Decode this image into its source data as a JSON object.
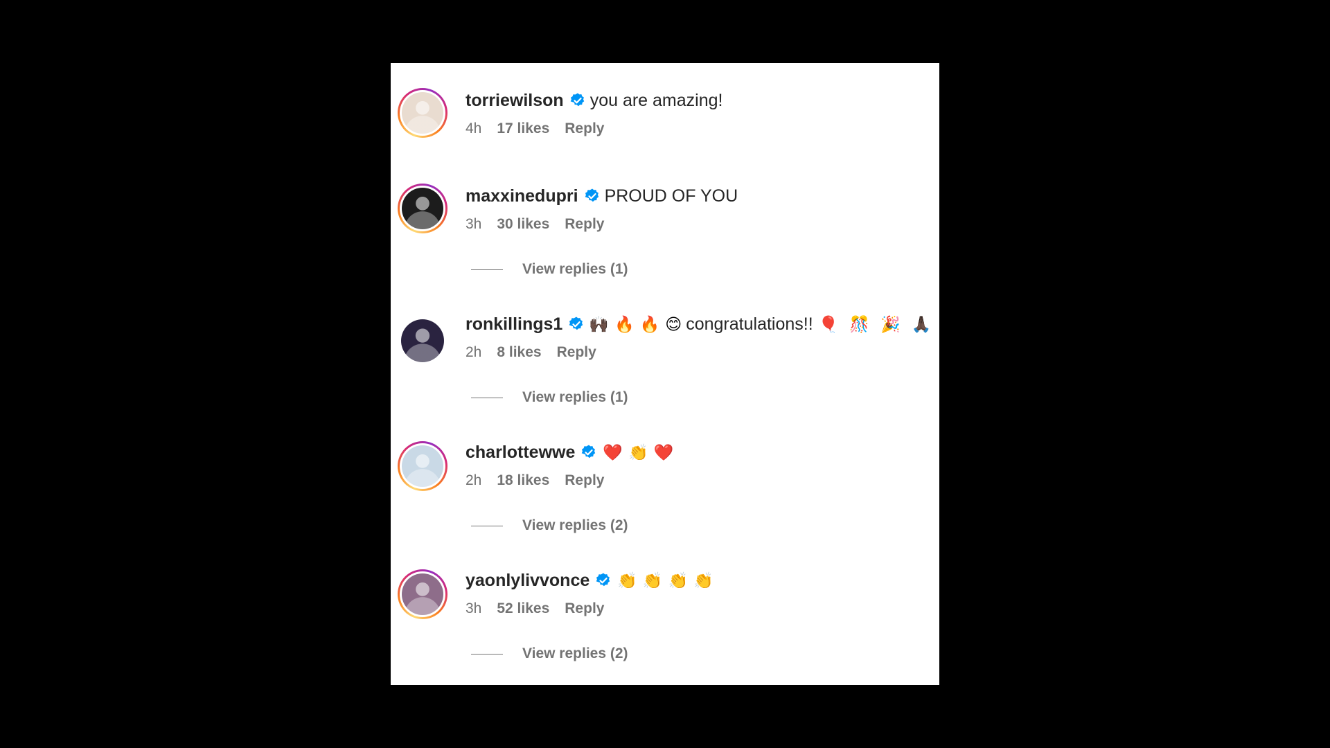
{
  "comments": [
    {
      "username": "torriewilson",
      "text": "you are amazing!",
      "emojis": [],
      "time": "4h",
      "likes": "17 likes",
      "reply": "Reply",
      "view_replies": null,
      "avatar": {
        "ring": true,
        "bg": "#e9dcd0"
      }
    },
    {
      "username": "maxxinedupri",
      "text": "PROUD OF YOU",
      "emojis": [],
      "time": "3h",
      "likes": "30 likes",
      "reply": "Reply",
      "view_replies": "View replies (1)",
      "avatar": {
        "ring": true,
        "bg": "#1c1c1c"
      }
    },
    {
      "username": "ronkillings1",
      "text": "congratulations!!",
      "emojis_before": [
        "🙌🏿",
        "🔥",
        "🔥",
        "😊"
      ],
      "emojis": [
        "🎈",
        "🎊",
        "🎉",
        "🙏🏿"
      ],
      "time": "2h",
      "likes": "8 likes",
      "reply": "Reply",
      "view_replies": "View replies (1)",
      "avatar": {
        "ring": false,
        "bg": "#2a2340"
      }
    },
    {
      "username": "charlottewwe",
      "text": "",
      "emojis": [
        "❤️",
        "👏",
        "❤️"
      ],
      "time": "2h",
      "likes": "18 likes",
      "reply": "Reply",
      "view_replies": "View replies (2)",
      "avatar": {
        "ring": true,
        "bg": "#c9d9e6"
      }
    },
    {
      "username": "yaonlylivvonce",
      "text": "",
      "emojis": [
        "👏",
        "👏",
        "👏",
        "👏"
      ],
      "time": "3h",
      "likes": "52 likes",
      "reply": "Reply",
      "view_replies": "View replies (2)",
      "avatar": {
        "ring": true,
        "bg": "#8e6d8a"
      }
    }
  ],
  "colors": {
    "verified": "#0095f6",
    "text": "#262626",
    "meta": "#737373",
    "background": "#000000",
    "panel": "#ffffff"
  }
}
